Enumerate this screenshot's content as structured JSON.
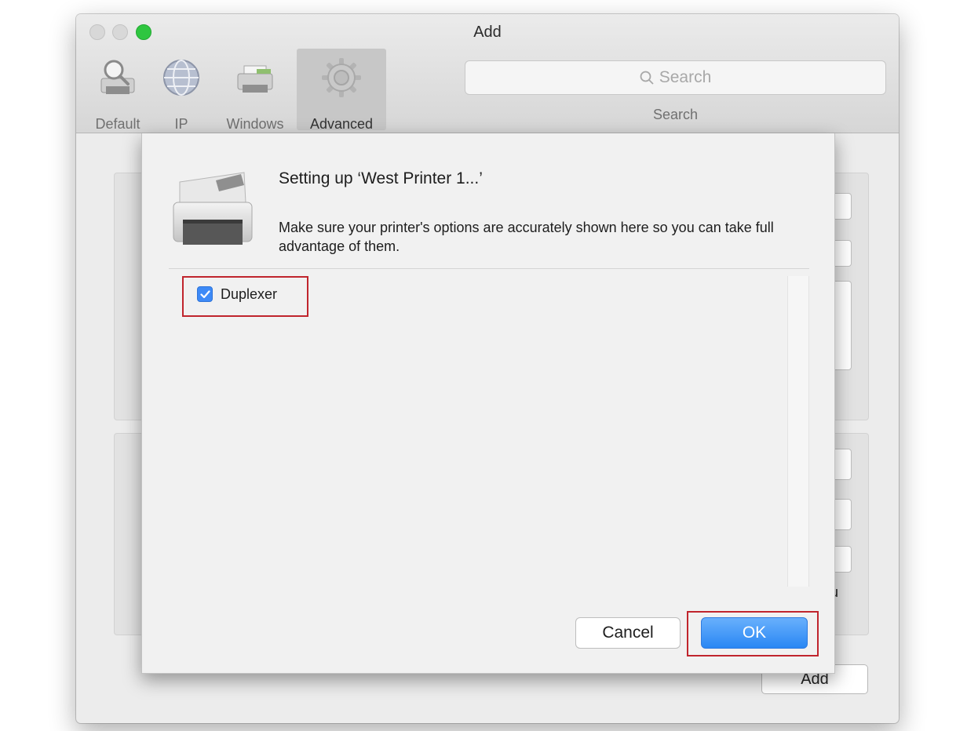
{
  "window": {
    "title": "Add"
  },
  "toolbar": {
    "items": [
      {
        "label": "Default",
        "icon": "default-printer-icon"
      },
      {
        "label": "IP",
        "icon": "globe-icon"
      },
      {
        "label": "Windows",
        "icon": "windows-printer-icon"
      },
      {
        "label": "Advanced",
        "icon": "gear-icon",
        "active": true
      }
    ],
    "search": {
      "placeholder": "Search",
      "label": "Search"
    }
  },
  "background": {
    "add_label": "Add",
    "partial_text": "u"
  },
  "sheet": {
    "title": "Setting up ‘West Printer 1...’",
    "message": "Make sure your printer's options are accurately shown here so you can take full advantage of them.",
    "options": [
      {
        "label": "Duplexer",
        "checked": true
      }
    ],
    "cancel_label": "Cancel",
    "ok_label": "OK"
  },
  "colors": {
    "accent": "#3d8af7",
    "highlight": "#c0252d",
    "zoom_button": "#2fc640"
  }
}
